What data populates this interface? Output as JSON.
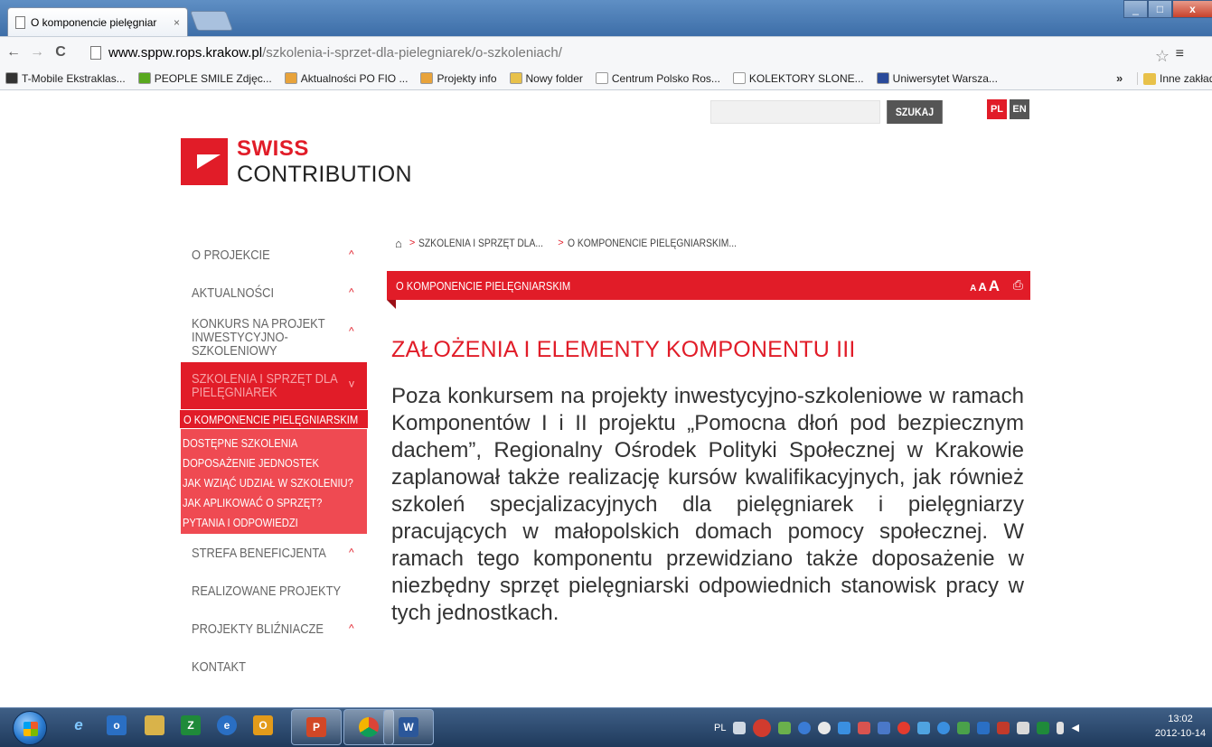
{
  "browser": {
    "tab_title": "O komponencie pielęgniar",
    "tab_close": "×",
    "url_host": "www.sppw.rops.krakow.pl",
    "url_path": "/szkolenia-i-sprzet-dla-pielegniarek/o-szkoleniach/",
    "bookmarks": [
      {
        "label": "T-Mobile Ekstraklas...",
        "color": "#333333"
      },
      {
        "label": "PEOPLE SMILE Zdjęc...",
        "color": "#58a81e"
      },
      {
        "label": "Aktualności PO FIO ...",
        "color": "#e8a33b"
      },
      {
        "label": "Projekty info",
        "color": "#e8a33b"
      },
      {
        "label": "Nowy folder",
        "color": "#e8c14a"
      },
      {
        "label": "Centrum Polsko Ros...",
        "color": "#ffffff"
      },
      {
        "label": "KOLEKTORY SLONE...",
        "color": "#ffffff"
      },
      {
        "label": "Uniwersytet Warsza...",
        "color": "#2a4a9a"
      }
    ],
    "bookmarks_more": "»",
    "other_bookmarks": "Inne zakładk"
  },
  "header": {
    "search_button": "SZUKAJ",
    "lang_pl": "PL",
    "lang_en": "EN",
    "logo_top": "SWISS",
    "logo_bottom": "CONTRIBUTION"
  },
  "sidebar": {
    "items": [
      {
        "label": "O PROJEKCIE"
      },
      {
        "label": "AKTUALNOŚCI"
      },
      {
        "label": "KONKURS NA PROJEKT INWESTYCYJNO-SZKOLENIOWY"
      },
      {
        "label": "SZKOLENIA I SPRZĘT DLA PIELĘGNIAREK"
      },
      {
        "label": "STREFA BENEFICJENTA"
      },
      {
        "label": "REALIZOWANE PROJEKTY"
      },
      {
        "label": "PROJEKTY BLIŹNIACZE"
      },
      {
        "label": "KONTAKT"
      }
    ],
    "submenu": [
      {
        "label": "O KOMPONENCIE PIELĘGNIARSKIM"
      },
      {
        "label": "DOSTĘPNE SZKOLENIA"
      },
      {
        "label": "DOPOSAŻENIE JEDNOSTEK"
      },
      {
        "label": "JAK WZIĄĆ UDZIAŁ W SZKOLENIU?"
      },
      {
        "label": "JAK APLIKOWAĆ O SPRZĘT?"
      },
      {
        "label": "PYTANIA I ODPOWIEDZI"
      }
    ],
    "accent_color": "#e11c28"
  },
  "main": {
    "breadcrumb": [
      "SZKOLENIA I SPRZĘT DLA...",
      "O KOMPONENCIE PIELĘGNIARSKIM..."
    ],
    "title_bar": "O KOMPONENCIE PIELĘGNIARSKIM",
    "font_sizes": [
      "A",
      "A",
      "A"
    ],
    "heading": "ZAŁOŻENIA I ELEMENTY KOMPONENTU III",
    "body": "Poza konkursem na projekty inwestycyjno-szkoleniowe w ramach Komponentów I i II projektu „Pomocna dłoń pod bezpiecznym dachem”, Regionalny Ośrodek Polityki Społecznej w Krakowie zaplanował także realizację kursów kwalifikacyjnych, jak również szkoleń specjalizacyjnych dla pielęgniarek i pielęgniarzy pracujących w małopolskich domach pomocy społecznej. W ramach tego komponentu przewidziano także doposażenie w niezbędny sprzęt pielęgniarski odpowiednich stanowisk pracy w tych jednostkach."
  },
  "taskbar": {
    "language": "PL",
    "time": "13:02",
    "date": "2012-10-14"
  }
}
